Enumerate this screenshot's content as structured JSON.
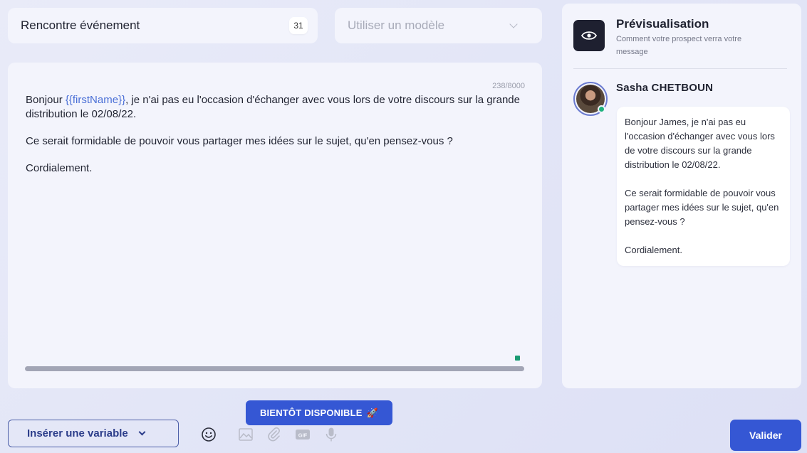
{
  "title_field": {
    "value": "Rencontre événement",
    "count": "31"
  },
  "template_select": {
    "placeholder": "Utiliser un modèle"
  },
  "editor": {
    "char_count": "238/8000",
    "line1_before": "Bonjour ",
    "variable": "{{firstName}}",
    "line1_after": ", je n'ai pas eu l'occasion d'échanger avec vous lors de votre discours sur la grande distribution le 02/08/22.",
    "paragraph2": "Ce serait formidable de pouvoir vous partager mes idées sur le sujet, qu'en pensez-vous ?",
    "paragraph3": "Cordialement."
  },
  "preview": {
    "title": "Prévisualisation",
    "subtitle": "Comment votre prospect verra votre message",
    "sender_name": "Sasha CHETBOUN",
    "bubble_p1": "Bonjour James, je n'ai pas eu l'occasion d'échanger avec vous lors de votre discours sur la grande distribution le 02/08/22.",
    "bubble_p2": "Ce serait formidable de pouvoir vous partager mes idées sur le sujet, qu'en pensez-vous ?",
    "bubble_p3": "Cordialement."
  },
  "toolbar": {
    "insert_variable_label": "Insérer une variable",
    "coming_soon_label": "BIENTÔT DISPONIBLE",
    "coming_soon_emoji": "🚀",
    "gif_label": "GIF",
    "validate_label": "Valider"
  },
  "icons": {
    "eye": "eye-icon",
    "emoji": "emoji-icon",
    "image": "image-icon",
    "attachment": "paperclip-icon",
    "gif": "gif-icon",
    "microphone": "microphone-icon"
  },
  "colors": {
    "primary": "#3557d4",
    "variable": "#4a6fd6",
    "online": "#1fb27e"
  }
}
